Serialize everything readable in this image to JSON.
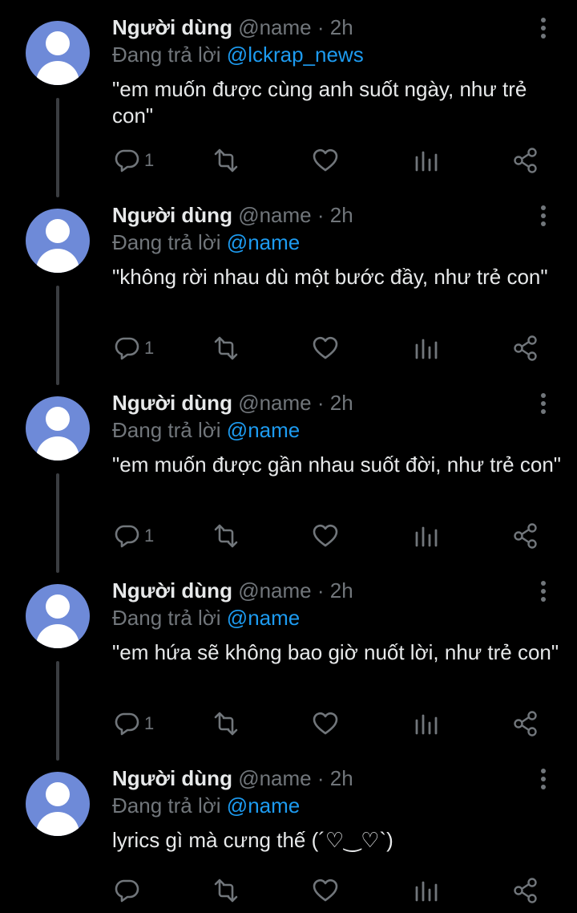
{
  "colors": {
    "background": "#000000",
    "text": "#e7e9ea",
    "muted": "#71767b",
    "accent": "#1d9bf0",
    "avatar": "#6e8ad8"
  },
  "icons": {
    "reply": "reply-icon",
    "retweet": "retweet-icon",
    "like": "heart-icon",
    "views": "analytics-icon",
    "share": "share-icon",
    "more": "more-icon"
  },
  "tweets": [
    {
      "display_name": "Người dùng",
      "handle": "@name",
      "separator": "·",
      "time": "2h",
      "replying_label": "Đang trả lời",
      "replying_to": "@lckrap_news",
      "text": "\"em muốn được cùng anh suốt ngày, như trẻ con\"",
      "reply_count": "1"
    },
    {
      "display_name": "Người dùng",
      "handle": "@name",
      "separator": "·",
      "time": "2h",
      "replying_label": "Đang trả lời",
      "replying_to": "@name",
      "text": "\"không rời nhau dù một bước đầy, như trẻ con\"",
      "reply_count": "1"
    },
    {
      "display_name": "Người dùng",
      "handle": "@name",
      "separator": "·",
      "time": "2h",
      "replying_label": "Đang trả lời",
      "replying_to": "@name",
      "text": "\"em muốn được gần nhau suốt đời, như trẻ con\"",
      "reply_count": "1"
    },
    {
      "display_name": "Người dùng",
      "handle": "@name",
      "separator": "·",
      "time": "2h",
      "replying_label": "Đang trả lời",
      "replying_to": "@name",
      "text": "\"em hứa sẽ không bao giờ nuốt lời, như trẻ con\"",
      "reply_count": "1"
    },
    {
      "display_name": "Người dùng",
      "handle": "@name",
      "separator": "·",
      "time": "2h",
      "replying_label": "Đang trả lời",
      "replying_to": "@name",
      "text": "lyrics gì mà cưng thế (´♡‿♡`)",
      "reply_count": ""
    }
  ]
}
